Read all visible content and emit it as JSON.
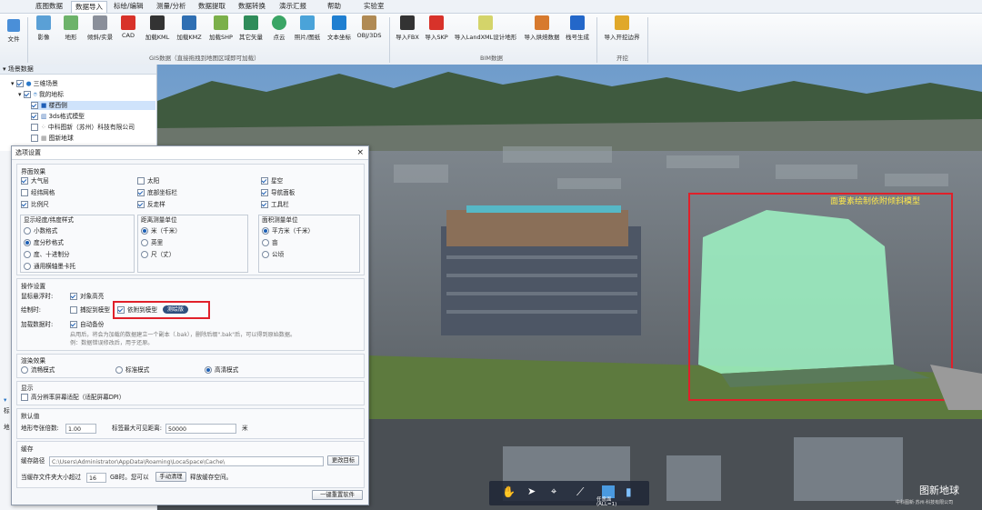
{
  "menubar": {
    "items": [
      "底图数据",
      "数据导入",
      "标绘/编辑",
      "测量/分析",
      "数据提取",
      "数据转换",
      "演示汇报",
      "帮助",
      "实验室"
    ],
    "active_index": 1
  },
  "ribbon": {
    "file_label": "文件",
    "gis_buttons": [
      "影像",
      "地形",
      "倾斜/实景",
      "CAD",
      "加载KML",
      "加载KMZ",
      "加载SHP",
      "其它矢量",
      "点云",
      "照片/图纸",
      "文本坐标",
      "OBJ/3DS"
    ],
    "gis_group": "GIS数据（直接拖拽到地图区域即可加载）",
    "bim_buttons": [
      "导入FBX",
      "导入SKP",
      "导入LandXML设计地形",
      "导入烘焙数据",
      "栈号生成"
    ],
    "bim_group": "BIM数据",
    "dev_buttons": [
      "导入开挖边界"
    ],
    "dev_group": "开挖"
  },
  "tree": {
    "header": "场景数据",
    "items": [
      {
        "label": "三维场景",
        "checked": true,
        "selected": false
      },
      {
        "label": "我的地标",
        "checked": true,
        "selected": false
      },
      {
        "label": "楼西侧",
        "checked": true,
        "selected": true
      },
      {
        "label": "3ds格式模型",
        "checked": true,
        "selected": false
      },
      {
        "label": "中科图新（苏州）科技有限公司",
        "checked": false,
        "selected": false
      },
      {
        "label": "图新地球",
        "checked": false,
        "selected": false
      }
    ]
  },
  "leftlow": {
    "label1": "标",
    "label2": "地"
  },
  "dialog": {
    "title": "选项设置",
    "close": "×",
    "sec_ui": "界面效果",
    "ui_items": [
      {
        "label": "大气层",
        "checked": true
      },
      {
        "label": "太阳",
        "checked": false
      },
      {
        "label": "星空",
        "checked": true
      },
      {
        "label": "经纬网格",
        "checked": false
      },
      {
        "label": "底部坐标栏",
        "checked": true
      },
      {
        "label": "导航面板",
        "checked": true
      },
      {
        "label": "比例尺",
        "checked": true
      },
      {
        "label": "反走样",
        "checked": true
      },
      {
        "label": "工具栏",
        "checked": true
      }
    ],
    "coord_title": "显示经度/纬度样式",
    "coord_items": [
      {
        "label": "小数格式",
        "checked": false
      },
      {
        "label": "度分秒格式",
        "checked": true
      },
      {
        "label": "度、十进制分",
        "checked": false
      },
      {
        "label": "通用横轴墨卡托",
        "checked": false
      }
    ],
    "dist_title": "距离测量单位",
    "dist_items": [
      {
        "label": "米（千米）",
        "checked": true
      },
      {
        "label": "英里",
        "checked": false
      },
      {
        "label": "尺（丈）",
        "checked": false
      }
    ],
    "area_title": "面积测量单位",
    "area_items": [
      {
        "label": "平方米（千米）",
        "checked": true
      },
      {
        "label": "亩",
        "checked": false
      },
      {
        "label": "公顷",
        "checked": false
      }
    ],
    "sec_op": "操作设置",
    "hover_label": "鼠标悬浮时:",
    "hover_opt": "对象高亮",
    "draw_label": "绘制时:",
    "draw_opt1": "捕捉到模型",
    "draw_opt2": "依附到模型",
    "draw_badge": "测绘版",
    "load_label": "加载数据时:",
    "load_opt": "自动备份",
    "load_desc1": "启用后，将会为加载的数据建立一个副本（.bak），删除后缀\".bak\"后，可以得到原始数据。",
    "load_desc2": "例：数据错误修改后，用于还原。",
    "sec_render": "渲染效果",
    "render_items": [
      {
        "label": "流畅模式",
        "checked": false
      },
      {
        "label": "标准模式",
        "checked": false
      },
      {
        "label": "高清模式",
        "checked": true
      }
    ],
    "sec_display": "显示",
    "display_opt": "高分辨率屏幕适配（适配屏幕DPI）",
    "sec_default": "默认值",
    "height_label": "地形夸张倍数:",
    "height_value": "1.00",
    "label_dist_label": "标签最大可见距离:",
    "label_dist_value": "50000",
    "label_dist_unit": "米",
    "sec_cache": "缓存",
    "cache_path_label": "缓存路径",
    "cache_path": "C:\\Users\\Administrator\\AppData\\Roaming\\LocaSpace\\Cache\\",
    "change_dir": "更改目标",
    "cache_size_pre": "当缓存文件夹大小超过",
    "cache_size": "16",
    "cache_size_post": "GB时。您可以",
    "manual_clean": "手动清理",
    "release": "释放缓存空间。",
    "reset": "一键重置软件"
  },
  "scene": {
    "annotation": "面要素绘制依附倾斜模型",
    "watermark": "图新地球",
    "watermark_sub": "中科图新·苏州·科技有限公司",
    "toolbar_caption": "任意面",
    "toolbar_caption2": "(ALL=1)",
    "colors": {
      "annotation_box": "#e0202a",
      "annotation_text": "#ffe84a",
      "model": "#9ff5c4"
    }
  }
}
